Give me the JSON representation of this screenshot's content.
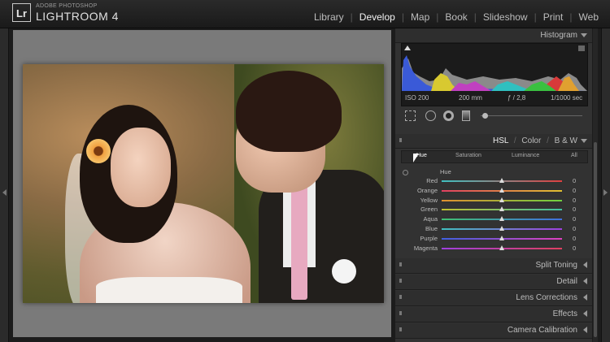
{
  "app": {
    "logo": "Lr",
    "brand_top": "ADOBE PHOTOSHOP",
    "brand_main": "LIGHTROOM 4"
  },
  "modules": [
    {
      "label": "Library",
      "active": false
    },
    {
      "label": "Develop",
      "active": true
    },
    {
      "label": "Map",
      "active": false
    },
    {
      "label": "Book",
      "active": false
    },
    {
      "label": "Slideshow",
      "active": false
    },
    {
      "label": "Print",
      "active": false
    },
    {
      "label": "Web",
      "active": false
    }
  ],
  "histogram": {
    "title": "Histogram",
    "iso": "ISO 200",
    "focal": "200 mm",
    "aperture": "ƒ / 2,8",
    "shutter": "1/1000 sec"
  },
  "hsl": {
    "tab_hsl": "HSL",
    "tab_color": "Color",
    "tab_bw": "B & W",
    "sep": "/",
    "subtabs": [
      "Hue",
      "Saturation",
      "Luminance",
      "All"
    ],
    "section_label": "Hue",
    "rows": [
      {
        "name": "Red",
        "value": "0",
        "colors": [
          "#40c0c0",
          "#e04040"
        ]
      },
      {
        "name": "Orange",
        "value": "0",
        "colors": [
          "#e04060",
          "#e0c030"
        ]
      },
      {
        "name": "Yellow",
        "value": "0",
        "colors": [
          "#e09030",
          "#70d040"
        ]
      },
      {
        "name": "Green",
        "value": "0",
        "colors": [
          "#c0c030",
          "#40c0a0"
        ]
      },
      {
        "name": "Aqua",
        "value": "0",
        "colors": [
          "#40c070",
          "#4070e0"
        ]
      },
      {
        "name": "Blue",
        "value": "0",
        "colors": [
          "#40c0c0",
          "#a040e0"
        ]
      },
      {
        "name": "Purple",
        "value": "0",
        "colors": [
          "#4060e0",
          "#e040c0"
        ]
      },
      {
        "name": "Magenta",
        "value": "0",
        "colors": [
          "#a040e0",
          "#e04060"
        ]
      }
    ]
  },
  "panels": [
    {
      "label": "Split Toning"
    },
    {
      "label": "Detail"
    },
    {
      "label": "Lens Corrections"
    },
    {
      "label": "Effects"
    },
    {
      "label": "Camera Calibration"
    }
  ]
}
